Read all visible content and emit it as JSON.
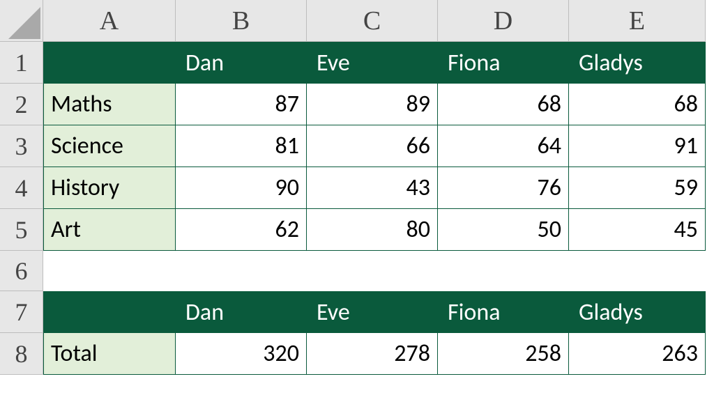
{
  "columns": [
    "A",
    "B",
    "C",
    "D",
    "E"
  ],
  "rows": [
    "1",
    "2",
    "3",
    "4",
    "5",
    "6",
    "7",
    "8"
  ],
  "people": [
    "Dan",
    "Eve",
    "Fiona",
    "Gladys"
  ],
  "subjects": [
    "Maths",
    "Science",
    "History",
    "Art"
  ],
  "table1": {
    "Maths": [
      87,
      89,
      68,
      68
    ],
    "Science": [
      81,
      66,
      64,
      91
    ],
    "History": [
      90,
      43,
      76,
      59
    ],
    "Art": [
      62,
      80,
      50,
      45
    ]
  },
  "totals_label": "Total",
  "totals": [
    320,
    278,
    258,
    263
  ],
  "chart_data": {
    "type": "table",
    "columns": [
      "Dan",
      "Eve",
      "Fiona",
      "Gladys"
    ],
    "rows": [
      "Maths",
      "Science",
      "History",
      "Art",
      "Total"
    ],
    "values": [
      [
        87,
        89,
        68,
        68
      ],
      [
        81,
        66,
        64,
        91
      ],
      [
        90,
        43,
        76,
        59
      ],
      [
        62,
        80,
        50,
        45
      ],
      [
        320,
        278,
        258,
        263
      ]
    ]
  }
}
